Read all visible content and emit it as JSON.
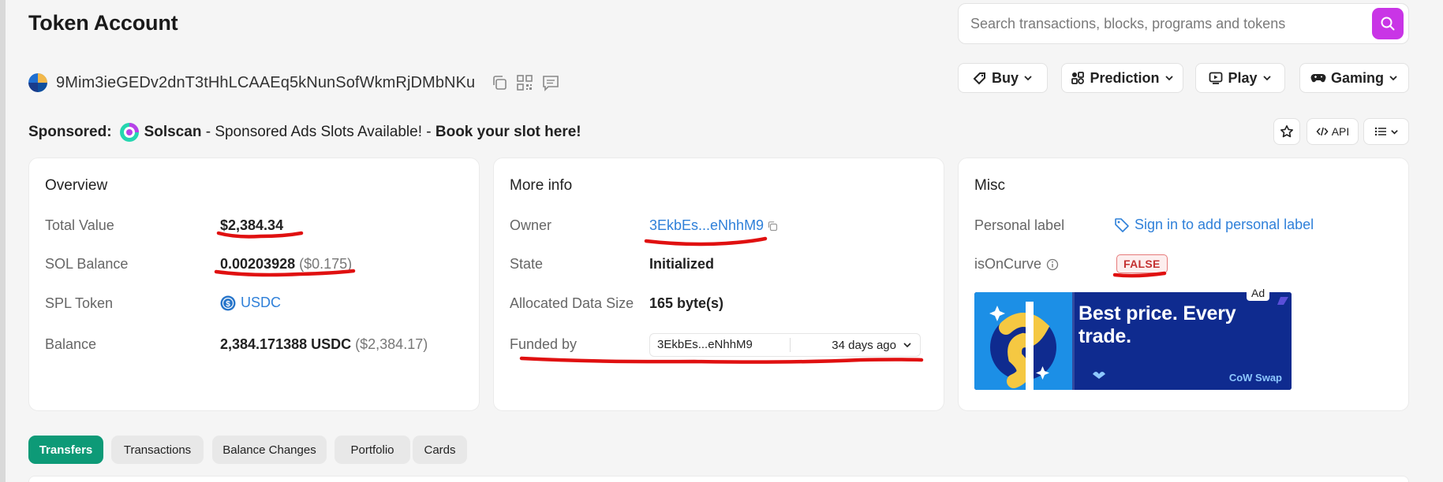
{
  "page": {
    "title": "Token Account"
  },
  "search": {
    "placeholder": "Search transactions, blocks, programs and tokens"
  },
  "account": {
    "address": "9Mim3ieGEDv2dnT3tHhLCAAEq5kNunSofWkmRjDMbNKu"
  },
  "nav": {
    "buy": "Buy",
    "prediction": "Prediction",
    "play": "Play",
    "gaming": "Gaming",
    "api": "API"
  },
  "sponsored": {
    "label": "Sponsored:",
    "brand": "Solscan",
    "text": " - Sponsored Ads Slots Available! - ",
    "cta": "Book your slot here!"
  },
  "overview": {
    "title": "Overview",
    "total_value_label": "Total Value",
    "total_value": "$2,384.34",
    "sol_balance_label": "SOL Balance",
    "sol_balance": "0.00203928",
    "sol_balance_usd": "($0.175)",
    "spl_token_label": "SPL Token",
    "spl_token": "USDC",
    "balance_label": "Balance",
    "balance": "2,384.171388 USDC",
    "balance_usd": "($2,384.17)"
  },
  "more_info": {
    "title": "More info",
    "owner_label": "Owner",
    "owner": "3EkbEs...eNhhM9",
    "state_label": "State",
    "state": "Initialized",
    "data_size_label": "Allocated Data Size",
    "data_size": "165 byte(s)",
    "funded_label": "Funded by",
    "funded_by": "3EkbEs...eNhhM9",
    "funded_ago": "34 days ago"
  },
  "misc": {
    "title": "Misc",
    "personal_label_label": "Personal label",
    "personal_label_link": "Sign in to add personal label",
    "is_on_curve_label": "isOnCurve",
    "is_on_curve": "FALSE",
    "ad_tag": "Ad",
    "ad_headline_1": "Best price. Every",
    "ad_headline_2": "trade.",
    "ad_brand": "CoW Swap"
  },
  "tabs": [
    {
      "label": "Transfers"
    },
    {
      "label": "Transactions"
    },
    {
      "label": "Balance Changes"
    },
    {
      "label": "Portfolio"
    },
    {
      "label": "Cards"
    }
  ],
  "colors": {
    "accent": "#0d9a77",
    "search_button": "#c935e6",
    "link": "#2f80d9",
    "annotation": "#e01010"
  }
}
